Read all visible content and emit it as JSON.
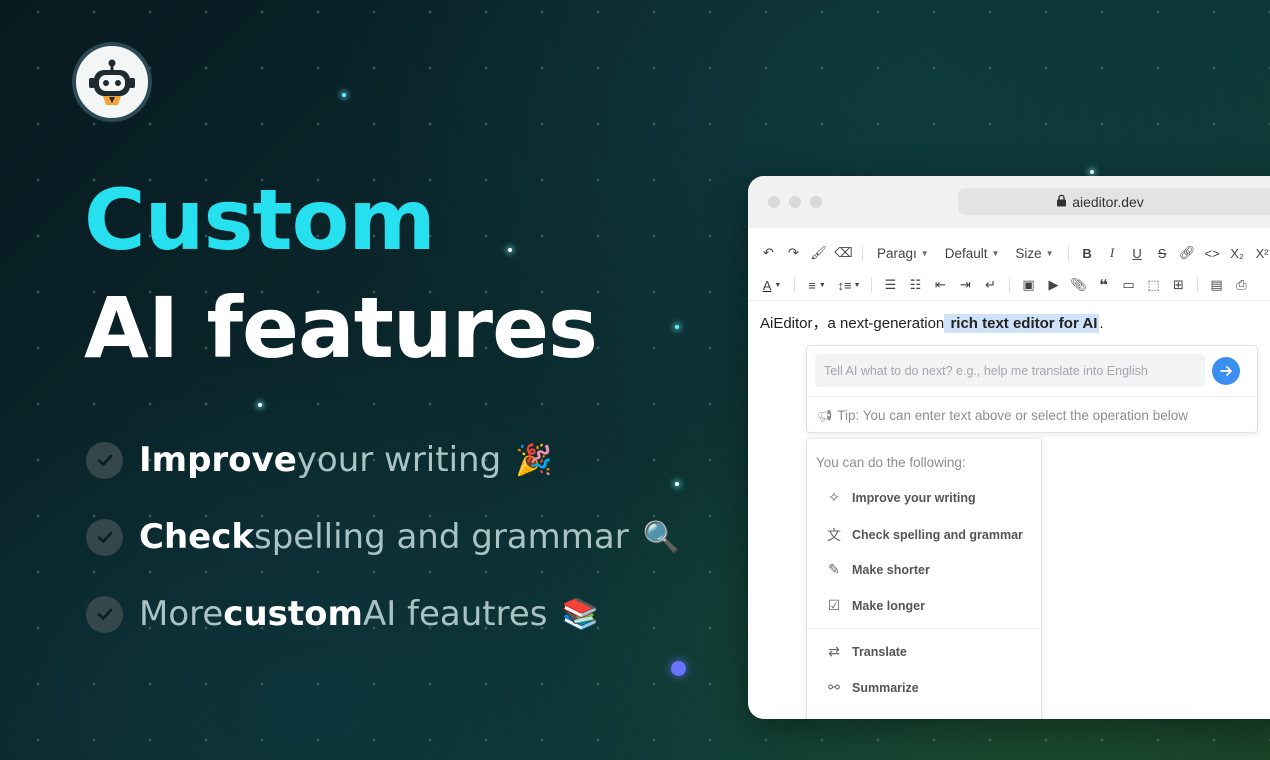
{
  "hero": {
    "title_line1": "Custom",
    "title_line2": "AI features",
    "features": [
      {
        "bold": "Improve",
        "rest": " your writing",
        "emoji": "🎉"
      },
      {
        "bold": "Check",
        "rest": " spelling and grammar",
        "emoji": "🔍"
      },
      {
        "pre": "More ",
        "bold": "custom",
        "rest": " AI feautres",
        "emoji": "📚"
      }
    ]
  },
  "browser": {
    "url": "aieditor.dev"
  },
  "toolbar": {
    "paragraph": "Paragı",
    "font_family": "Default",
    "font_size": "Size"
  },
  "editor": {
    "text_plain": "AiEditor，a next-generation",
    "text_highlight": " rich text editor for AI",
    "text_end": "."
  },
  "ai_panel": {
    "input_placeholder": "Tell AI what to do next? e.g., help me translate into English",
    "tip": "Tip: You can enter text above or select the operation below",
    "menu_heading": "You can do the following:",
    "menu_items": [
      {
        "label": "Improve your writing",
        "icon": "sparkle-icon"
      },
      {
        "label": "Check spelling and grammar",
        "icon": "spellcheck-icon"
      },
      {
        "label": "Make shorter",
        "icon": "edit-doc-icon"
      },
      {
        "label": "Make longer",
        "icon": "edit-list-icon"
      },
      {
        "label": "Translate",
        "icon": "translate-icon"
      },
      {
        "label": "Summarize",
        "icon": "nodes-icon"
      }
    ]
  },
  "colors": {
    "accent_cyan": "#27e0ef",
    "send_button": "#3a8ff0",
    "highlight": "#cfe2f7"
  }
}
